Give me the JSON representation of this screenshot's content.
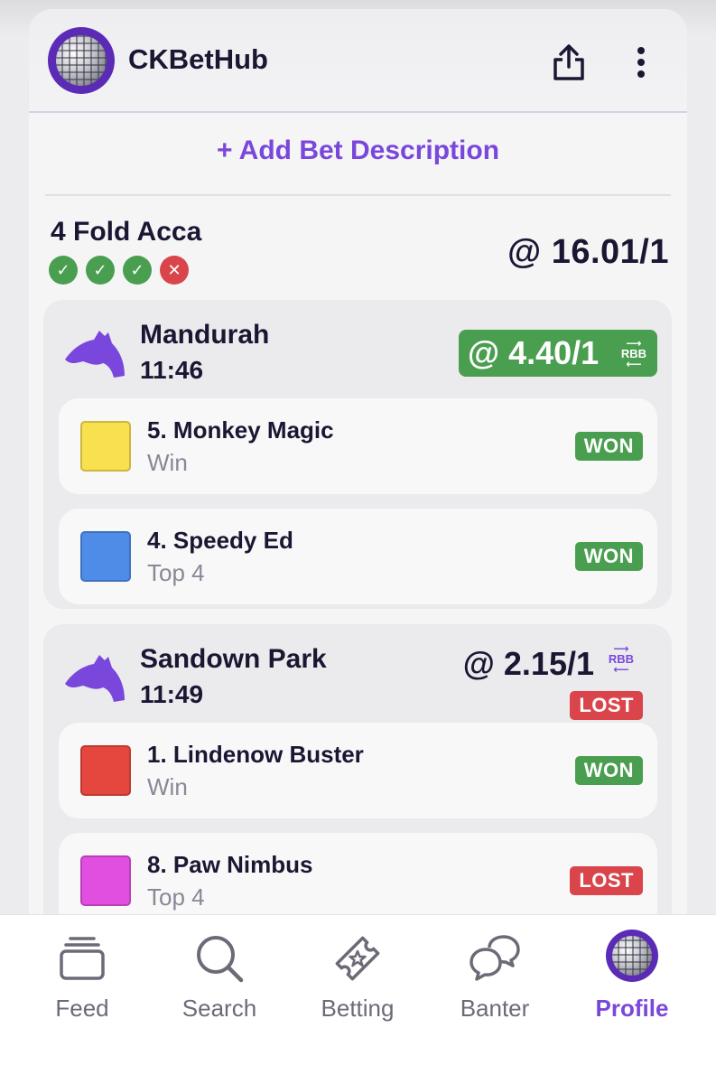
{
  "header": {
    "brand": "CKBetHub",
    "share_icon": "share-icon",
    "more_icon": "more-vertical-icon"
  },
  "add_description": "+ Add Bet Description",
  "bet": {
    "title": "4 Fold Acca",
    "odds": "@ 16.01/1",
    "leg_statuses": [
      "won",
      "won",
      "won",
      "lost"
    ]
  },
  "races": [
    {
      "venue": "Mandurah",
      "time": "11:46",
      "odds": "@ 4.40/1",
      "rbb": "RBB",
      "result": "",
      "runners": [
        {
          "name": "5. Monkey Magic",
          "type": "Win",
          "result": "WON",
          "silk_color": "#f9e04f"
        },
        {
          "name": "4. Speedy Ed",
          "type": "Top 4",
          "result": "WON",
          "silk_color": "#4e8ce8"
        }
      ]
    },
    {
      "venue": "Sandown Park",
      "time": "11:49",
      "odds": "@ 2.15/1",
      "rbb": "RBB",
      "result": "LOST",
      "runners": [
        {
          "name": "1. Lindenow Buster",
          "type": "Win",
          "result": "WON",
          "silk_color": "#e5473f"
        },
        {
          "name": "8. Paw Nimbus",
          "type": "Top 4",
          "result": "LOST",
          "silk_color": "#e04fe0"
        }
      ]
    }
  ],
  "tabbar": {
    "tabs": [
      {
        "label": "Feed",
        "icon": "feed-icon"
      },
      {
        "label": "Search",
        "icon": "search-icon"
      },
      {
        "label": "Betting",
        "icon": "ticket-icon"
      },
      {
        "label": "Banter",
        "icon": "chat-icon"
      },
      {
        "label": "Profile",
        "icon": "avatar-icon"
      }
    ],
    "active": "Profile"
  },
  "colors": {
    "accent": "#7a47dc",
    "won": "#4a9e4f",
    "lost": "#d9454a",
    "text": "#1c1633"
  }
}
